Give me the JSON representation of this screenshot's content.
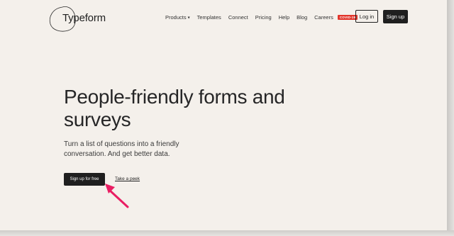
{
  "header": {
    "logo_text": "Typeform",
    "nav": [
      {
        "label": "Products",
        "has_dropdown": true
      },
      {
        "label": "Templates"
      },
      {
        "label": "Connect"
      },
      {
        "label": "Pricing"
      },
      {
        "label": "Help"
      },
      {
        "label": "Blog"
      },
      {
        "label": "Careers"
      }
    ],
    "badge": "COVID-19",
    "login_label": "Log in",
    "signup_label": "Sign up"
  },
  "hero": {
    "title": "People-friendly forms and surveys",
    "subtitle": "Turn a list of questions into a friendly conversation. And get better data.",
    "cta_label": "Sign up for free",
    "peek_label": "Take a peek"
  },
  "annotation": {
    "arrow_color": "#e91e63",
    "arrow_icon": "pointer-arrow-icon"
  },
  "colors": {
    "background": "#f4f0eb",
    "primary_button": "#1f1f1f",
    "badge": "#e2352b"
  }
}
